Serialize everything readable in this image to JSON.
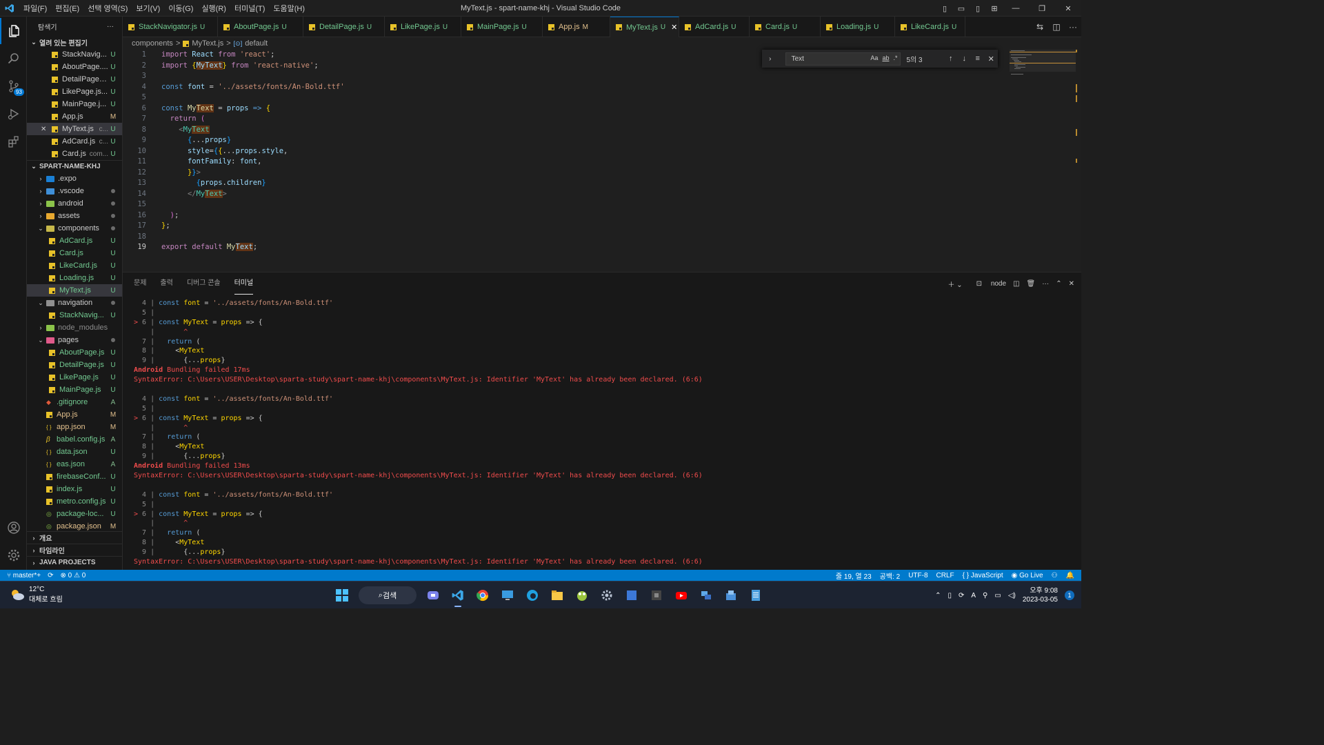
{
  "window": {
    "title": "MyText.js - spart-name-khj - Visual Studio Code"
  },
  "menu": [
    "파일(F)",
    "편집(E)",
    "선택 영역(S)",
    "보기(V)",
    "이동(G)",
    "실행(R)",
    "터미널(T)",
    "도움말(H)"
  ],
  "activity": {
    "scm_badge": "93"
  },
  "sidebar": {
    "title": "탐색기",
    "more": "···",
    "open_editors_label": "열려 있는 편집기",
    "open_editors": [
      {
        "name": "StackNavig...",
        "status": "U"
      },
      {
        "name": "AboutPage....",
        "status": "U"
      },
      {
        "name": "DetailPage.j...",
        "status": "U"
      },
      {
        "name": "LikePage.js...",
        "status": "U"
      },
      {
        "name": "MainPage.j...",
        "status": "U"
      },
      {
        "name": "App.js",
        "status": "M"
      },
      {
        "name": "MyText.js",
        "desc": "c...",
        "status": "U"
      },
      {
        "name": "AdCard.js",
        "desc": "c...",
        "status": "U"
      },
      {
        "name": "Card.js",
        "desc": "com...",
        "status": "U"
      }
    ],
    "project_label": "SPART-NAME-KHJ",
    "tree": [
      {
        "name": ".expo",
        "depth": 1,
        "type": "folder",
        "open": false,
        "color": "#1a7fd4"
      },
      {
        "name": ".vscode",
        "depth": 1,
        "type": "folder",
        "open": false,
        "color": "#3f8fd8",
        "dot": true
      },
      {
        "name": "android",
        "depth": 1,
        "type": "folder",
        "open": false,
        "color": "#8bc34a",
        "dot": true
      },
      {
        "name": "assets",
        "depth": 1,
        "type": "folder",
        "open": false,
        "color": "#e8a930",
        "dot": true
      },
      {
        "name": "components",
        "depth": 1,
        "type": "folder",
        "open": true,
        "color": "#c6b84a",
        "dot": true
      },
      {
        "name": "AdCard.js",
        "depth": 2,
        "type": "js",
        "status": "U"
      },
      {
        "name": "Card.js",
        "depth": 2,
        "type": "js",
        "status": "U"
      },
      {
        "name": "LikeCard.js",
        "depth": 2,
        "type": "js",
        "status": "U"
      },
      {
        "name": "Loading.js",
        "depth": 2,
        "type": "js",
        "status": "U"
      },
      {
        "name": "MyText.js",
        "depth": 2,
        "type": "js",
        "status": "U",
        "selected": true
      },
      {
        "name": "navigation",
        "depth": 1,
        "type": "folder",
        "open": true,
        "color": "#8f8f8f",
        "dot": true
      },
      {
        "name": "StackNavig...",
        "depth": 2,
        "type": "js",
        "status": "U"
      },
      {
        "name": "node_modules",
        "depth": 1,
        "type": "folder",
        "open": false,
        "color": "#8bc34a",
        "muted": true
      },
      {
        "name": "pages",
        "depth": 1,
        "type": "folder",
        "open": true,
        "color": "#e05a8a",
        "dot": true
      },
      {
        "name": "AboutPage.js",
        "depth": 2,
        "type": "js",
        "status": "U"
      },
      {
        "name": "DetailPage.js",
        "depth": 2,
        "type": "js",
        "status": "U"
      },
      {
        "name": "LikePage.js",
        "depth": 2,
        "type": "js",
        "status": "U"
      },
      {
        "name": "MainPage.js",
        "depth": 2,
        "type": "js",
        "status": "U"
      },
      {
        "name": ".gitignore",
        "depth": 1,
        "type": "git",
        "status": "A"
      },
      {
        "name": "App.js",
        "depth": 1,
        "type": "js",
        "status": "M"
      },
      {
        "name": "app.json",
        "depth": 1,
        "type": "json",
        "status": "M"
      },
      {
        "name": "babel.config.js",
        "depth": 1,
        "type": "babel",
        "status": "A"
      },
      {
        "name": "data.json",
        "depth": 1,
        "type": "json",
        "status": "U"
      },
      {
        "name": "eas.json",
        "depth": 1,
        "type": "json",
        "status": "A"
      },
      {
        "name": "firebaseConf...",
        "depth": 1,
        "type": "js",
        "status": "U"
      },
      {
        "name": "index.js",
        "depth": 1,
        "type": "js",
        "status": "U"
      },
      {
        "name": "metro.config.js",
        "depth": 1,
        "type": "js",
        "status": "U"
      },
      {
        "name": "package-loc...",
        "depth": 1,
        "type": "npm",
        "status": "U"
      },
      {
        "name": "package.json",
        "depth": 1,
        "type": "npm",
        "status": "M"
      }
    ],
    "bottom_sections": [
      "개요",
      "타임라인",
      "JAVA PROJECTS"
    ]
  },
  "tabs": [
    {
      "name": "StackNavigator.js",
      "status": "U"
    },
    {
      "name": "AboutPage.js",
      "status": "U"
    },
    {
      "name": "DetailPage.js",
      "status": "U"
    },
    {
      "name": "LikePage.js",
      "status": "U"
    },
    {
      "name": "MainPage.js",
      "status": "U"
    },
    {
      "name": "App.js",
      "status": "M"
    },
    {
      "name": "MyText.js",
      "status": "U",
      "active": true
    },
    {
      "name": "AdCard.js",
      "status": "U"
    },
    {
      "name": "Card.js",
      "status": "U"
    },
    {
      "name": "Loading.js",
      "status": "U"
    },
    {
      "name": "LikeCard.js",
      "status": "U"
    }
  ],
  "breadcrumb": [
    "components",
    ">",
    "MyText.js",
    ">",
    "default"
  ],
  "editor": {
    "current_line": 19,
    "lines": [
      [
        [
          "kw",
          "import"
        ],
        [
          "p",
          " "
        ],
        [
          "var",
          "React"
        ],
        [
          "p",
          " "
        ],
        [
          "kw",
          "from"
        ],
        [
          "p",
          " "
        ],
        [
          "str",
          "'react'"
        ],
        [
          "p",
          ";"
        ]
      ],
      [
        [
          "kw",
          "import"
        ],
        [
          "p",
          " "
        ],
        [
          "br1",
          "{"
        ],
        [
          "hlv",
          "MyText"
        ],
        [
          "br1",
          "}"
        ],
        [
          "p",
          " "
        ],
        [
          "kw",
          "from"
        ],
        [
          "p",
          " "
        ],
        [
          "str",
          "'react-native'"
        ],
        [
          "p",
          ";"
        ]
      ],
      [],
      [
        [
          "kb",
          "const"
        ],
        [
          "p",
          " "
        ],
        [
          "var",
          "font"
        ],
        [
          "p",
          " = "
        ],
        [
          "str",
          "'../assets/fonts/An-Bold.ttf'"
        ]
      ],
      [],
      [
        [
          "kb",
          "const"
        ],
        [
          "p",
          " "
        ],
        [
          "fn",
          "My"
        ],
        [
          "hlf",
          "Text"
        ],
        [
          "p",
          " = "
        ],
        [
          "var",
          "props"
        ],
        [
          "p",
          " "
        ],
        [
          "kb",
          "=>"
        ],
        [
          "p",
          " "
        ],
        [
          "br1",
          "{"
        ]
      ],
      [
        [
          "p",
          "  "
        ],
        [
          "kw",
          "return"
        ],
        [
          "p",
          " "
        ],
        [
          "br2",
          "("
        ]
      ],
      [
        [
          "p",
          "    "
        ],
        [
          "grey",
          "<"
        ],
        [
          "cls",
          "My"
        ],
        [
          "hlc",
          "Text"
        ]
      ],
      [
        [
          "p",
          "      "
        ],
        [
          "br3",
          "{"
        ],
        [
          "p",
          "..."
        ],
        [
          "var",
          "props"
        ],
        [
          "br3",
          "}"
        ]
      ],
      [
        [
          "p",
          "      "
        ],
        [
          "var",
          "style"
        ],
        [
          "p",
          "="
        ],
        [
          "br3",
          "{"
        ],
        [
          "br1",
          "{"
        ],
        [
          "p",
          "..."
        ],
        [
          "var",
          "props"
        ],
        [
          "p",
          "."
        ],
        [
          "var",
          "style"
        ],
        [
          "p",
          ","
        ]
      ],
      [
        [
          "p",
          "      "
        ],
        [
          "var",
          "fontFamily"
        ],
        [
          "p",
          ": "
        ],
        [
          "var",
          "font"
        ],
        [
          "p",
          ","
        ]
      ],
      [
        [
          "p",
          "      "
        ],
        [
          "br1",
          "}"
        ],
        [
          "br3",
          "}"
        ],
        [
          "grey",
          ">"
        ]
      ],
      [
        [
          "p",
          "        "
        ],
        [
          "br3",
          "{"
        ],
        [
          "var",
          "props"
        ],
        [
          "p",
          "."
        ],
        [
          "var",
          "children"
        ],
        [
          "br3",
          "}"
        ]
      ],
      [
        [
          "p",
          "      "
        ],
        [
          "grey",
          "</"
        ],
        [
          "cls",
          "My"
        ],
        [
          "hlc",
          "Text"
        ],
        [
          "grey",
          ">"
        ]
      ],
      [],
      [
        [
          "p",
          "  "
        ],
        [
          "br2",
          ")"
        ],
        [
          "p",
          ";"
        ]
      ],
      [
        [
          "br1",
          "}"
        ],
        [
          "p",
          ";"
        ]
      ],
      [],
      [
        [
          "kw",
          "export"
        ],
        [
          "p",
          " "
        ],
        [
          "kw",
          "default"
        ],
        [
          "p",
          " "
        ],
        [
          "fn",
          "My"
        ],
        [
          "hlv",
          "Text"
        ],
        [
          "p",
          ";"
        ]
      ]
    ]
  },
  "find": {
    "query": "Text",
    "opt_case": "Aa",
    "opt_word": "ab",
    "opt_regex": ".*",
    "count": "5의 3"
  },
  "panel": {
    "tabs": [
      "문제",
      "출력",
      "디버그 콘솔",
      "터미널"
    ],
    "active_tab": "터미널",
    "shell": "node",
    "terminal_block": [
      [
        [
          "grey",
          "  4 | "
        ],
        [
          "tk",
          "const"
        ],
        [
          "p",
          " "
        ],
        [
          "tv",
          "font"
        ],
        [
          "p",
          " = "
        ],
        [
          "ts",
          "'../assets/fonts/An-Bold.ttf'"
        ]
      ],
      [
        [
          "grey",
          "  5 |"
        ]
      ],
      [
        [
          "red",
          "> "
        ],
        [
          "grey",
          "6 | "
        ],
        [
          "tk",
          "const"
        ],
        [
          "p",
          " "
        ],
        [
          "tv",
          "MyText"
        ],
        [
          "p",
          " = "
        ],
        [
          "tv",
          "props"
        ],
        [
          "p",
          " => {"
        ]
      ],
      [
        [
          "grey",
          "    | "
        ],
        [
          "red",
          "      ^"
        ]
      ],
      [
        [
          "grey",
          "  7 | "
        ],
        [
          "p",
          "  "
        ],
        [
          "tk",
          "return"
        ],
        [
          "p",
          " ("
        ]
      ],
      [
        [
          "grey",
          "  8 | "
        ],
        [
          "p",
          "    <"
        ],
        [
          "tv",
          "MyText"
        ]
      ],
      [
        [
          "grey",
          "  9 | "
        ],
        [
          "p",
          "      {..."
        ],
        [
          "tv",
          "props"
        ],
        [
          "p",
          "}"
        ]
      ]
    ],
    "bundling": [
      {
        "label": "Android",
        "msg": " Bundling failed ",
        "time": "17ms"
      },
      {
        "label": "Android",
        "msg": " Bundling failed ",
        "time": "13ms"
      },
      {
        "label": "",
        "msg": "",
        "time": ""
      }
    ],
    "error": "SyntaxError: C:\\Users\\USER\\Desktop\\sparta-study\\spart-name-khj\\components\\MyText.js: Identifier 'MyText' has already been declared. (6:6)"
  },
  "statusbar": {
    "branch": "master*+",
    "errors": "0",
    "warnings": "0",
    "position": "줄 19, 열 23",
    "spaces": "공백: 2",
    "encoding": "UTF-8",
    "eol": "CRLF",
    "language": "JavaScript",
    "golive": "Go Live"
  },
  "taskbar": {
    "temp": "12°C",
    "weather": "대체로 흐림",
    "search": "검색",
    "time": "오후 9:08",
    "date": "2023-03-05",
    "notif": "1"
  }
}
